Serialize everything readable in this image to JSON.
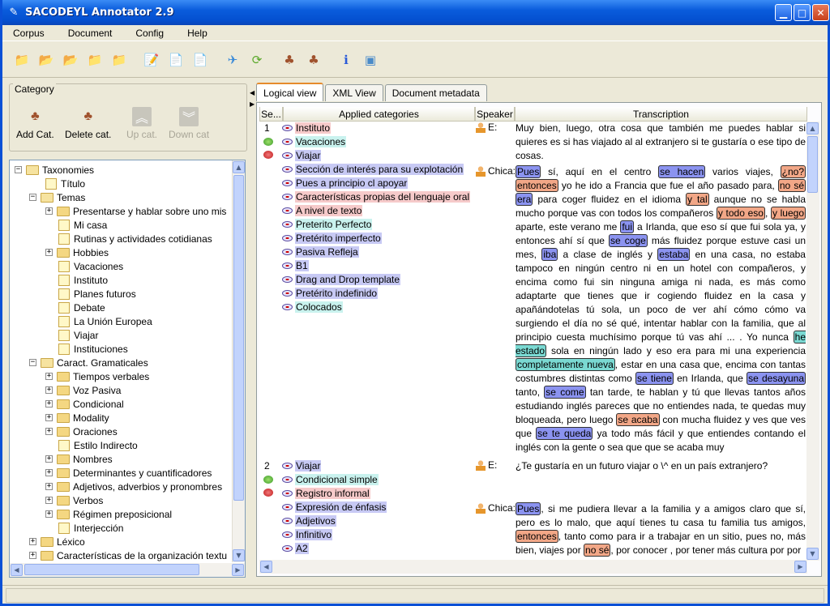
{
  "window": {
    "title": "SACODEYL Annotator 2.9"
  },
  "menu": [
    "Corpus",
    "Document",
    "Config",
    "Help"
  ],
  "category_panel": {
    "legend": "Category",
    "buttons": [
      {
        "label": "Add Cat.",
        "enabled": true
      },
      {
        "label": "Delete cat.",
        "enabled": true
      },
      {
        "label": "Up cat.",
        "enabled": false
      },
      {
        "label": "Down cat",
        "enabled": false
      }
    ]
  },
  "tree": [
    {
      "label": "Taxonomies",
      "level": 0,
      "kind": "folder",
      "expanded": true
    },
    {
      "label": "Título",
      "level": 2,
      "kind": "leaf"
    },
    {
      "label": "Temas",
      "level": 1,
      "kind": "folder",
      "expanded": true
    },
    {
      "label": "Presentarse y hablar sobre uno mis",
      "level": 2,
      "kind": "folder",
      "expanded": false
    },
    {
      "label": "Mi casa",
      "level": 3,
      "kind": "leaf"
    },
    {
      "label": "Rutinas y actividades cotidianas",
      "level": 3,
      "kind": "leaf"
    },
    {
      "label": "Hobbies",
      "level": 2,
      "kind": "folder",
      "expanded": false
    },
    {
      "label": "Vacaciones",
      "level": 3,
      "kind": "leaf"
    },
    {
      "label": "Instituto",
      "level": 3,
      "kind": "leaf"
    },
    {
      "label": "Planes futuros",
      "level": 3,
      "kind": "leaf"
    },
    {
      "label": "Debate",
      "level": 3,
      "kind": "leaf"
    },
    {
      "label": "La Unión Europea",
      "level": 3,
      "kind": "leaf"
    },
    {
      "label": "Viajar",
      "level": 3,
      "kind": "leaf"
    },
    {
      "label": "Instituciones",
      "level": 3,
      "kind": "leaf"
    },
    {
      "label": "Caract. Gramaticales",
      "level": 1,
      "kind": "folder",
      "expanded": true
    },
    {
      "label": "Tiempos verbales",
      "level": 2,
      "kind": "folder",
      "expanded": false
    },
    {
      "label": "Voz Pasiva",
      "level": 2,
      "kind": "folder",
      "expanded": false
    },
    {
      "label": "Condicional",
      "level": 2,
      "kind": "folder",
      "expanded": false
    },
    {
      "label": "Modality",
      "level": 2,
      "kind": "folder",
      "expanded": false
    },
    {
      "label": "Oraciones",
      "level": 2,
      "kind": "folder",
      "expanded": false
    },
    {
      "label": "Estilo Indirecto",
      "level": 3,
      "kind": "leaf"
    },
    {
      "label": "Nombres",
      "level": 2,
      "kind": "folder",
      "expanded": false
    },
    {
      "label": "Determinantes y cuantificadores",
      "level": 2,
      "kind": "folder",
      "expanded": false
    },
    {
      "label": "Adjetivos, adverbios y pronombres",
      "level": 2,
      "kind": "folder",
      "expanded": false
    },
    {
      "label": "Verbos",
      "level": 2,
      "kind": "folder",
      "expanded": false
    },
    {
      "label": "Régimen preposicional",
      "level": 2,
      "kind": "folder",
      "expanded": false
    },
    {
      "label": "Interjección",
      "level": 3,
      "kind": "leaf"
    },
    {
      "label": "Léxico",
      "level": 1,
      "kind": "folder",
      "expanded": false
    },
    {
      "label": "Características de la organización textu",
      "level": 1,
      "kind": "folder",
      "expanded": false
    }
  ],
  "tabs": [
    "Logical view",
    "XML View",
    "Document metadata"
  ],
  "active_tab": 0,
  "columns": [
    "Se...",
    "Applied categories",
    "Speaker",
    "Transcription"
  ],
  "colors": {
    "blue": "#c7c9f4",
    "cyan": "#c9f2ee",
    "pink": "#f6caca",
    "highlight_blue": "#8b93f0",
    "highlight_orange": "#f2a787",
    "highlight_cyan": "#7ad9d2"
  },
  "segments": [
    {
      "number": "1",
      "categories": [
        {
          "label": "Instituto",
          "color": "#f6caca"
        },
        {
          "label": "Vacaciones",
          "color": "#c9f2ee"
        },
        {
          "label": "Viajar",
          "color": "#c7c9f4"
        },
        {
          "label": "Sección de interés para su explotación",
          "color": "#c7c9f4"
        },
        {
          "label": "Pues a principio cl apoyar",
          "color": "#c7c9f4"
        },
        {
          "label": "Características propias del lenguaje oral",
          "color": "#f6caca"
        },
        {
          "label": "A nivel de texto",
          "color": "#f6caca"
        },
        {
          "label": "Preterito Perfecto",
          "color": "#c9f2ee"
        },
        {
          "label": "Pretérito imperfecto",
          "color": "#c7c9f4"
        },
        {
          "label": "Pasiva Refleja",
          "color": "#c7c9f4"
        },
        {
          "label": "B1",
          "color": "#c7c9f4"
        },
        {
          "label": "Drag and Drop template",
          "color": "#c7c9f4"
        },
        {
          "label": "Pretérito indefinido",
          "color": "#c7c9f4"
        },
        {
          "label": "Colocados",
          "color": "#c9f2ee"
        }
      ],
      "turns": [
        {
          "speaker": "E:",
          "text": "Muy bien, luego, otra cosa que también me puedes hablar si quieres es si has viajado al al extranjero si te gustaría o ese tipo de cosas."
        },
        {
          "speaker": "Chica:",
          "text": "Pues sí, aquí en el centro se hacen varios viajes, ¿no? entonces yo he ido a Francia que fue el año pasado para, no sé era para coger fluidez en el idioma y tal aunque no se habla mucho porque vas con todos los compañeros y todo eso, y luego aparte, este verano me fui a Irlanda, que eso sí que fui sola ya, y entonces ahí sí que se coge más fluidez porque estuve casi un mes, iba a clase de inglés y estaba en una casa, no estaba tampoco en ningún centro ni en un hotel con compañeros, y encima como fui sin ninguna amiga ni nada, es más como adaptarte que tienes que ir cogiendo fluidez en la casa y apañándotelas tú sola, un poco de ver ahí cómo cómo va surgiendo el día no sé qué, intentar hablar con la familia, que al principio cuesta muchísimo porque tú vas ahí ... . Yo nunca he estado sola en ningún lado y eso era para mi una experiencia completamente nueva, estar en una casa que, encima con tantas costumbres distintas como se tiene en Irlanda, que se desayuna tanto, se come tan tarde, te hablan y tú que llevas tantos años estudiando inglés pareces que no entiendes nada, te quedas muy bloqueada, pero luego se acaba con mucha fluidez y ves que ves que se te queda ya todo más fácil y que entiendes contando el inglés con la gente o sea que que se acaba muy"
        }
      ]
    },
    {
      "number": "2",
      "categories": [
        {
          "label": "Viajar",
          "color": "#c7c9f4"
        },
        {
          "label": "Condicional simple",
          "color": "#c9f2ee"
        },
        {
          "label": "Registro informal",
          "color": "#f6caca"
        },
        {
          "label": "Expresión de énfasis",
          "color": "#c7c9f4"
        },
        {
          "label": "Adjetivos",
          "color": "#c7c9f4"
        },
        {
          "label": "Infinitivo",
          "color": "#c7c9f4"
        },
        {
          "label": "A2",
          "color": "#c7c9f4"
        }
      ],
      "turns": [
        {
          "speaker": "E:",
          "text": "¿Te gustaría en un futuro viajar o \\^ en un país extranjero?"
        },
        {
          "speaker": "Chica:",
          "text": "Pues, si me pudiera llevar a la familia y a amigos claro que sí, pero es lo malo, que aquí tienes tu casa tu familia tus amigos, entonces, tanto como para ir a trabajar en un sitio, pues no, más bien, viajes por no sé, por conocer , por tener más cultura por por"
        }
      ]
    }
  ]
}
